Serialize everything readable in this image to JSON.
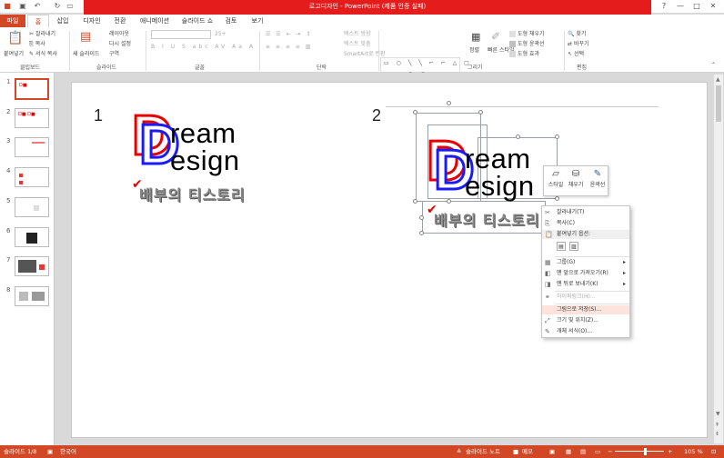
{
  "window": {
    "title": "로고디자인 - PowerPoint (제품 인증 실패)",
    "controls": [
      "?",
      "—",
      "□",
      "✕"
    ]
  },
  "ribbon_tabs": [
    "파일",
    "홈",
    "삽입",
    "디자인",
    "전환",
    "애니메이션",
    "슬라이드 쇼",
    "검토",
    "보기"
  ],
  "ribbon": {
    "clipboard": {
      "paste": "붙여넣기",
      "cut": "잘라내기",
      "copy": "복사",
      "format_painter": "서식 복사",
      "label": "클립보드"
    },
    "slides": {
      "new_slide": "새 슬라이드",
      "layout": "레이아웃",
      "reset": "다시 설정",
      "section": "구역",
      "label": "슬라이드"
    },
    "font": {
      "size": "25+",
      "label": "글꼴"
    },
    "paragraph": {
      "text_direction": "텍스트 방향",
      "align_text": "텍스트 맞춤",
      "smartart": "SmartArt로 변환",
      "label": "단락"
    },
    "drawing": {
      "arrange": "정렬",
      "quick_styles": "빠른 스타일",
      "shape_fill": "도형 채우기",
      "shape_outline": "도형 윤곽선",
      "shape_effects": "도형 효과",
      "label": "그리기"
    },
    "editing": {
      "find": "찾기",
      "replace": "바꾸기",
      "select": "선택",
      "label": "편집"
    }
  },
  "thumbnails": [
    "1",
    "2",
    "3",
    "4",
    "5",
    "6",
    "7",
    "8"
  ],
  "slide": {
    "number_1": "1",
    "number_2": "2",
    "logo": {
      "big_letter": "D",
      "line1": "ream",
      "line2": "esign",
      "check": "✔",
      "korean": "배부의 티스토리"
    }
  },
  "mini_toolbar": {
    "style": "스타일",
    "fill": "채우기",
    "outline": "윤곽선"
  },
  "context_menu": {
    "items": [
      {
        "label": "잘라내기(T)",
        "icon": "scissors-icon",
        "state": "normal"
      },
      {
        "label": "복사(C)",
        "icon": "copy-icon",
        "state": "normal"
      },
      {
        "label": "붙여넣기 옵션:",
        "icon": "paste-icon",
        "state": "header"
      },
      {
        "label": "그룹(G)",
        "icon": "group-icon",
        "state": "normal"
      },
      {
        "label": "맨 앞으로 가져오기(R)",
        "icon": "bring-front-icon",
        "state": "normal"
      },
      {
        "label": "맨 뒤로 보내기(K)",
        "icon": "send-back-icon",
        "state": "normal"
      },
      {
        "label": "하이퍼링크(H)...",
        "icon": "hyperlink-icon",
        "state": "disabled"
      },
      {
        "label": "그림으로 저장(S)...",
        "icon": "save-picture-icon",
        "state": "highlighted"
      },
      {
        "label": "크기 및 위치(Z)...",
        "icon": "size-icon",
        "state": "normal"
      },
      {
        "label": "개체 서식(O)...",
        "icon": "format-object-icon",
        "state": "normal"
      }
    ]
  },
  "statusbar": {
    "slide_info": "슬라이드 1/8",
    "language": "한국어",
    "notes": "슬라이드 노트",
    "comments": "메모",
    "zoom": "105 %"
  },
  "colors": {
    "accent": "#d24726",
    "title_bar": "#e41c1c",
    "logo_red": "#e60000",
    "logo_blue": "#1a1aff"
  }
}
